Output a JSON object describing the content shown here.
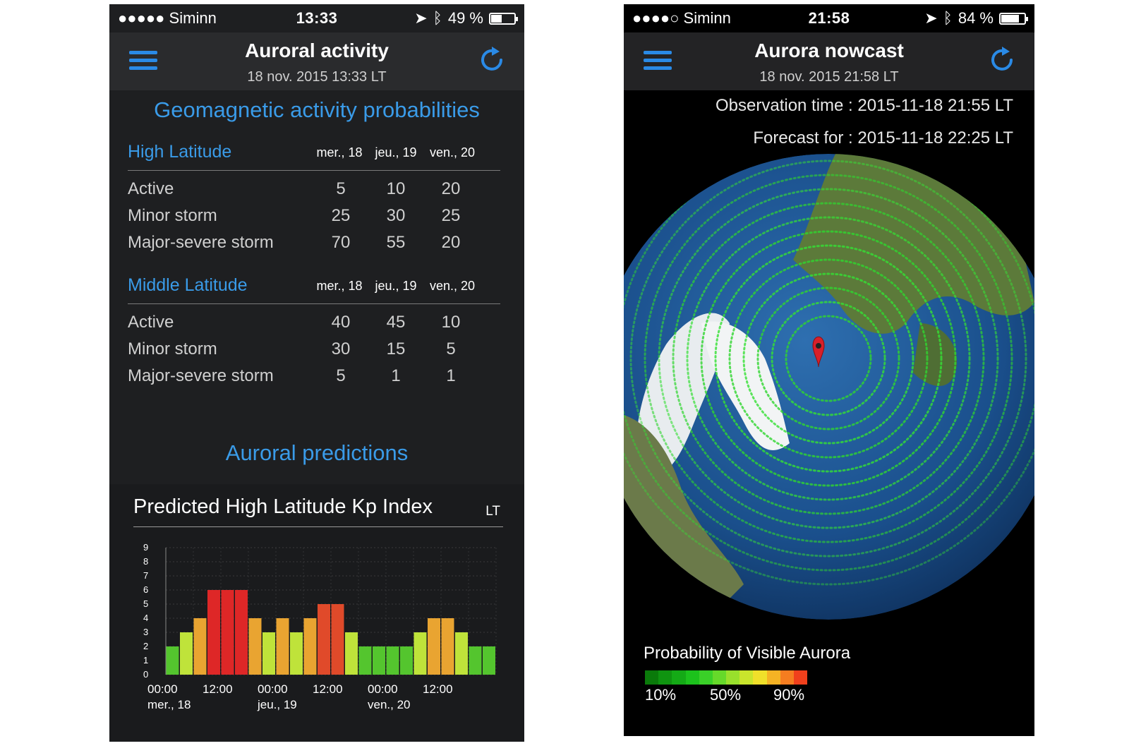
{
  "left": {
    "status": {
      "carrier": "●●●●● Siminn",
      "time": "13:33",
      "battery": "49 %",
      "battery_level": 0.49
    },
    "nav": {
      "title": "Auroral activity",
      "subtitle": "18 nov. 2015 13:33 LT"
    },
    "geomagnetic_title": "Geomagnetic activity probabilities",
    "high_latitude": {
      "title": "High Latitude",
      "days": [
        "mer., 18",
        "jeu., 19",
        "ven., 20"
      ],
      "rows": [
        {
          "label": "Active",
          "values": [
            "5",
            "10",
            "20"
          ]
        },
        {
          "label": "Minor storm",
          "values": [
            "25",
            "30",
            "25"
          ]
        },
        {
          "label": "Major-severe storm",
          "values": [
            "70",
            "55",
            "20"
          ]
        }
      ]
    },
    "middle_latitude": {
      "title": "Middle Latitude",
      "days": [
        "mer., 18",
        "jeu., 19",
        "ven., 20"
      ],
      "rows": [
        {
          "label": "Active",
          "values": [
            "40",
            "45",
            "10"
          ]
        },
        {
          "label": "Minor storm",
          "values": [
            "30",
            "15",
            "5"
          ]
        },
        {
          "label": "Major-severe storm",
          "values": [
            "5",
            "1",
            "1"
          ]
        }
      ]
    },
    "predictions_title": "Auroral predictions",
    "chart_header": {
      "title": "Predicted High Latitude Kp Index",
      "unit": "LT"
    }
  },
  "right": {
    "status": {
      "carrier": "●●●●○ Siminn",
      "time": "21:58",
      "battery": "84 %",
      "battery_level": 0.84
    },
    "nav": {
      "title": "Aurora nowcast",
      "subtitle": "18 nov. 2015 21:58 LT"
    },
    "observation": "Observation time : 2015-11-18 21:55 LT",
    "forecast": "Forecast for : 2015-11-18 22:25 LT",
    "legend": {
      "title": "Probability of Visible Aurora",
      "labels": [
        "10%",
        "50%",
        "90%"
      ]
    }
  },
  "chart_data": {
    "type": "bar",
    "title": "Predicted High Latitude Kp Index",
    "ylim": [
      0,
      9
    ],
    "yticks": [
      "0",
      "1",
      "2",
      "3",
      "4",
      "5",
      "6",
      "7",
      "8",
      "9"
    ],
    "xtick_labels": [
      {
        "time": "00:00",
        "day": "mer., 18"
      },
      {
        "time": "12:00",
        "day": ""
      },
      {
        "time": "00:00",
        "day": "jeu., 19"
      },
      {
        "time": "12:00",
        "day": ""
      },
      {
        "time": "00:00",
        "day": "ven., 20"
      },
      {
        "time": "12:00",
        "day": ""
      }
    ],
    "values": [
      2,
      3,
      4,
      6,
      6,
      6,
      4,
      3,
      4,
      3,
      4,
      5,
      5,
      3,
      2,
      2,
      2,
      2,
      3,
      4,
      4,
      3,
      2,
      2
    ],
    "colors": {
      "2": "#54c52e",
      "3": "#bfe33a",
      "4": "#e9a431",
      "5": "#e04a2a",
      "6": "#de2727"
    }
  }
}
